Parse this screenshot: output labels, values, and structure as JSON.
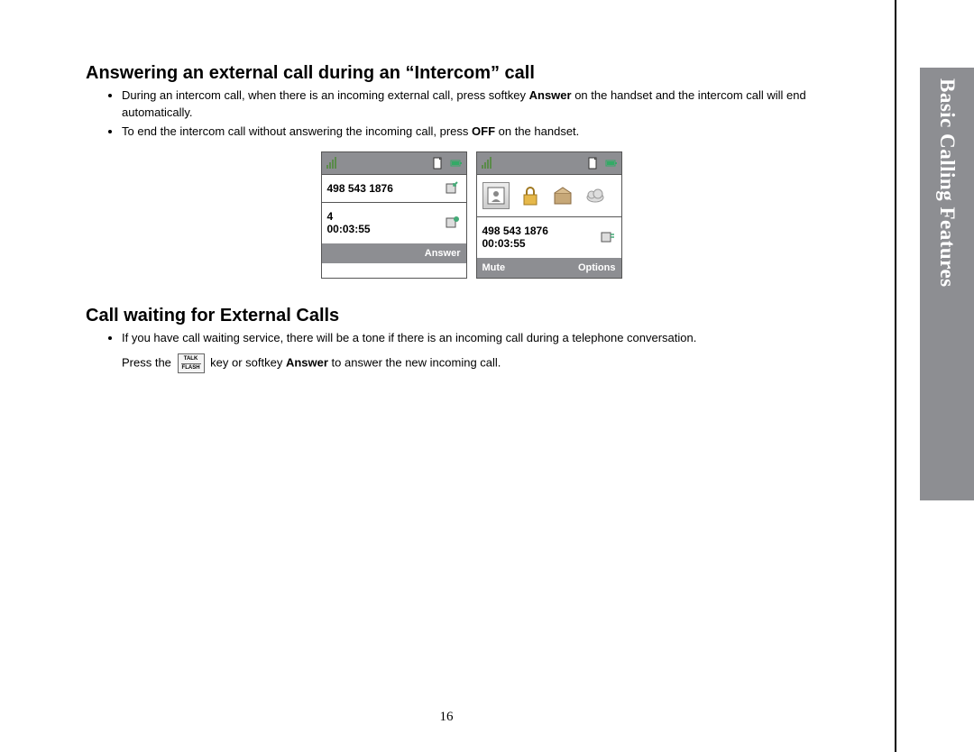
{
  "side_tab": "Basic Calling Features",
  "section1": {
    "title": "Answering an external call during an “Intercom” call",
    "b1_a": "During an intercom call, when there is an incoming external call, press softkey ",
    "b1_bold": "Answer",
    "b1_b": " on the handset and the intercom call will end automatically.",
    "b2_a": "To end the intercom call without answering the incoming call, press ",
    "b2_bold": "OFF",
    "b2_b": " on the handset."
  },
  "screen1": {
    "row1_number": "498 543 1876",
    "row2_line": "4",
    "row2_time": "00:03:55",
    "softkey_right": "Answer"
  },
  "screen2": {
    "row2_number": "498 543 1876",
    "row2_time": "00:03:55",
    "softkey_left": "Mute",
    "softkey_right": "Options"
  },
  "section2": {
    "title": "Call waiting for External Calls",
    "b1": "If you have call waiting service, there will be a tone if there is an incoming call during a telephone conversation.",
    "press_a": "Press the ",
    "press_b": " key or softkey ",
    "press_bold": "Answer",
    "press_c": " to answer the new incoming call."
  },
  "talk_key": {
    "top": "TALK",
    "bottom": "FLASH"
  },
  "page_number": "16",
  "icons": {
    "signal": "signal-icon",
    "doc": "page-icon",
    "battery": "battery-icon",
    "call_in": "incoming-call-icon",
    "call_active": "active-call-icon",
    "connected": "connected-call-icon",
    "contacts": "contacts-icon",
    "lock": "lock-icon",
    "box": "box-icon",
    "cloud": "cloud-icon"
  }
}
